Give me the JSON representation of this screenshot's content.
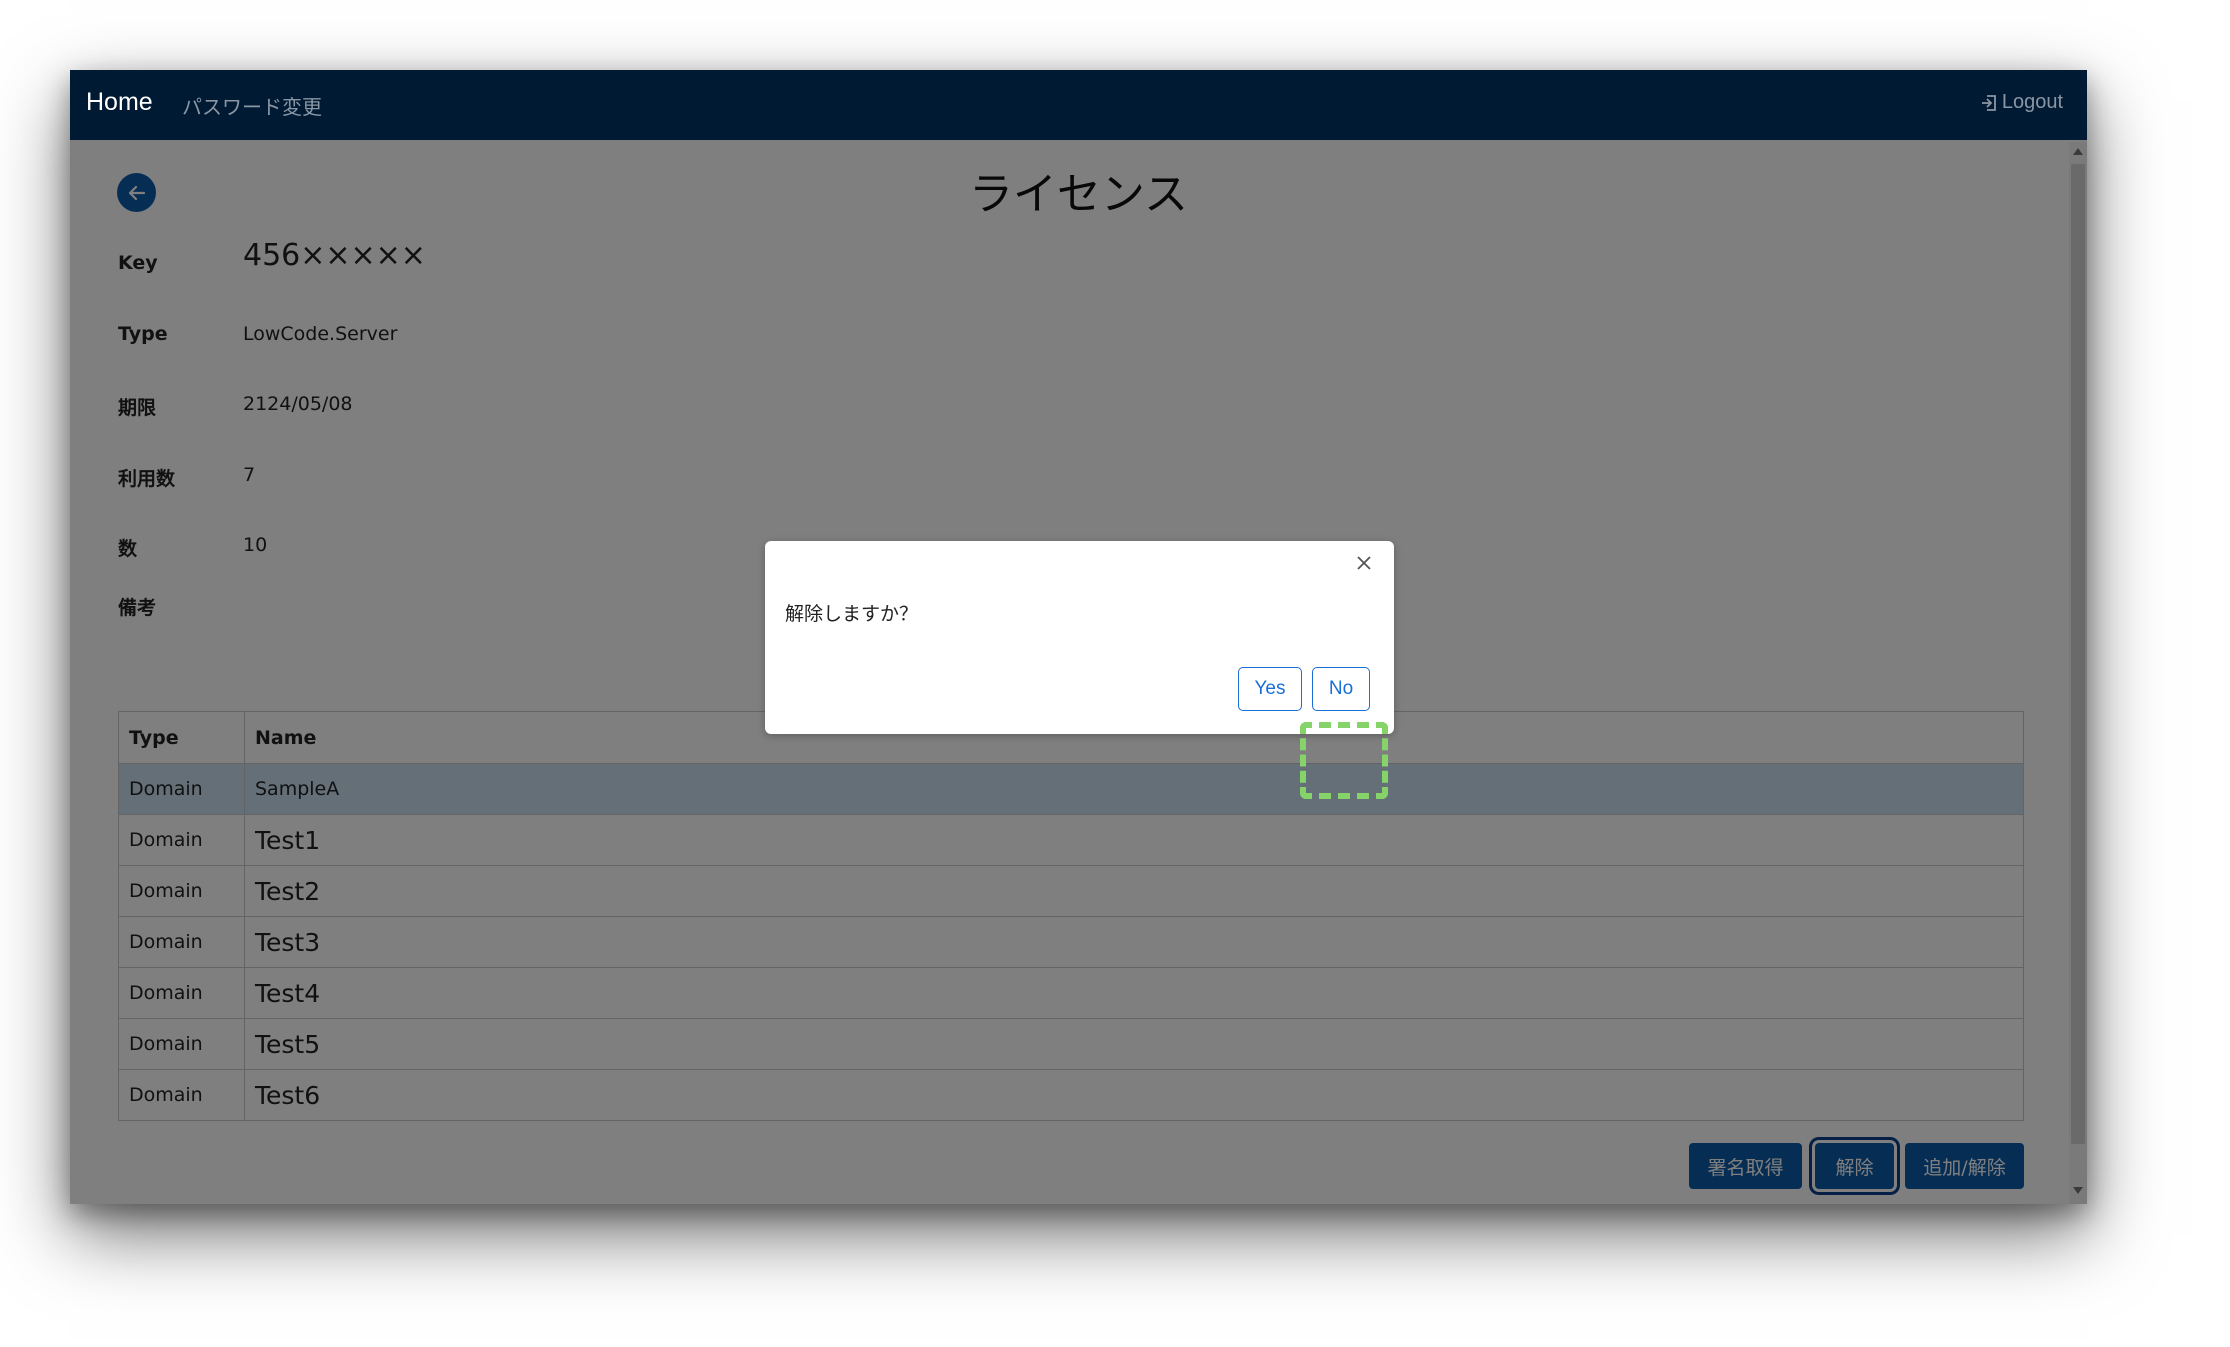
{
  "navbar": {
    "home": "Home",
    "password_change": "パスワード変更",
    "logout": "Logout"
  },
  "page": {
    "title": "ライセンス"
  },
  "fields": [
    {
      "label": "Key",
      "value": "456×××××"
    },
    {
      "label": "Type",
      "value": "LowCode.Server"
    },
    {
      "label": "期限",
      "value": "2124/05/08"
    },
    {
      "label": "利用数",
      "value": "7"
    },
    {
      "label": "数",
      "value": "10"
    },
    {
      "label": "備考",
      "value": ""
    }
  ],
  "table": {
    "headers": [
      "Type",
      "Name"
    ],
    "rows": [
      {
        "type": "Domain",
        "name": "SampleA"
      },
      {
        "type": "Domain",
        "name": "Test1"
      },
      {
        "type": "Domain",
        "name": "Test2"
      },
      {
        "type": "Domain",
        "name": "Test3"
      },
      {
        "type": "Domain",
        "name": "Test4"
      },
      {
        "type": "Domain",
        "name": "Test5"
      },
      {
        "type": "Domain",
        "name": "Test6"
      }
    ]
  },
  "buttons": {
    "sign": "署名取得",
    "remove": "解除",
    "add_remove": "追加/解除"
  },
  "modal": {
    "message": "解除しますか？",
    "yes": "Yes",
    "no": "No"
  },
  "colors": {
    "navbar": "#001a33",
    "primary": "#0d5cab",
    "highlight": "#86d36a",
    "selected_row": "#c9dff0"
  }
}
